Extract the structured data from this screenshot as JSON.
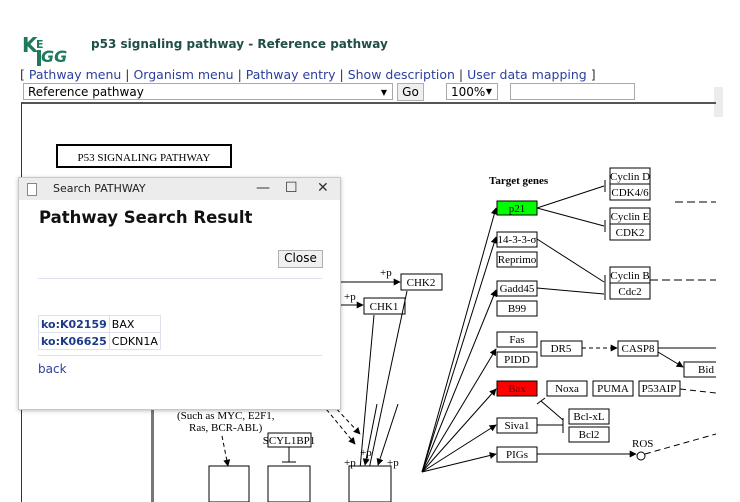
{
  "header": {
    "logo_text": "KEGG",
    "title": "p53 signaling pathway - Reference pathway"
  },
  "nav": {
    "open_bracket": "[ ",
    "close_bracket": " ]",
    "separator": " | ",
    "links": [
      "Pathway menu",
      "Organism menu",
      "Pathway entry",
      "Show description",
      "User data mapping"
    ]
  },
  "toolbar": {
    "pathway_select_value": "Reference pathway",
    "go_label": "Go",
    "zoom_select_value": "100%",
    "search_value": ""
  },
  "map": {
    "title": "P53 SIGNALING PATHWAY",
    "section_label": "Target genes",
    "oncogene_note": [
      "(Such as MYC, E2F1,",
      "Ras, BCR-ABL)"
    ],
    "phospho_label": "+p",
    "nodes": {
      "chk1": "CHK1",
      "chk2": "CHK2",
      "scyl1bp1": "SCYL1BP1",
      "p21": "p21",
      "s1433": "14-3-3-σ",
      "reprimo": "Reprimo",
      "gadd45": "Gadd45",
      "b99": "B99",
      "fas": "Fas",
      "pidd": "PIDD",
      "bax": "Bax",
      "siva1": "Siva1",
      "pigs": "PIGs",
      "cyclin_d": "Cyclin D",
      "cdk46": "CDK4/6",
      "cyclin_e": "Cyclin E",
      "cdk2": "CDK2",
      "cyclin_b": "Cyclin B",
      "cdc2": "Cdc2",
      "dr5": "DR5",
      "casp8": "CASP8",
      "bid": "Bid",
      "noxa": "Noxa",
      "puma": "PUMA",
      "p53aip": "P53AIP",
      "bclxl": "Bcl-xL",
      "bcl2": "Bcl2",
      "ros": "ROS"
    },
    "highlight_colors": {
      "p21": "#00ff00",
      "bax": "#ff0000"
    }
  },
  "dialog": {
    "window_title": "Search PATHWAY",
    "heading": "Pathway Search Result",
    "close_label": "Close",
    "results": [
      {
        "id": "ko:K02159",
        "name": "BAX"
      },
      {
        "id": "ko:K06625",
        "name": "CDKN1A"
      }
    ],
    "back_label": "back",
    "controls": {
      "minimize": "—",
      "maximize": "☐",
      "close": "✕"
    }
  }
}
